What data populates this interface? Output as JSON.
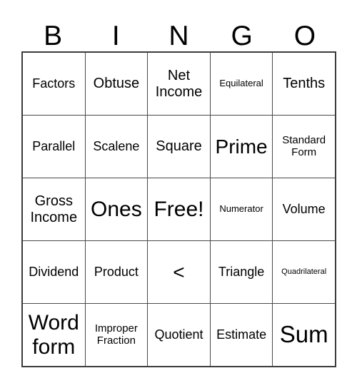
{
  "card": {
    "title": "BINGO Card",
    "header_letters": [
      "B",
      "I",
      "N",
      "G",
      "O"
    ],
    "colors": {
      "background": "#ffffff",
      "text": "#000000",
      "outer_border": "#3b3b3b",
      "inner_border": "#4a4a4a"
    },
    "rows": [
      [
        {
          "label": "Factors",
          "size": "md"
        },
        {
          "label": "Obtuse",
          "size": "lg"
        },
        {
          "label": "Net Income",
          "size": "lg"
        },
        {
          "label": "Equilateral",
          "size": "sm"
        },
        {
          "label": "Tenths",
          "size": "lg"
        }
      ],
      [
        {
          "label": "Parallel",
          "size": "md"
        },
        {
          "label": "Scalene",
          "size": "md"
        },
        {
          "label": "Square",
          "size": "lg"
        },
        {
          "label": "Prime",
          "size": "xl"
        },
        {
          "label": "Standard Form",
          "size": "smd"
        }
      ],
      [
        {
          "label": "Gross Income",
          "size": "lg"
        },
        {
          "label": "Ones",
          "size": "xxl"
        },
        {
          "label": "Free!",
          "size": "xxl"
        },
        {
          "label": "Numerator",
          "size": "sm"
        },
        {
          "label": "Volume",
          "size": "md"
        }
      ],
      [
        {
          "label": "Dividend",
          "size": "md"
        },
        {
          "label": "Product",
          "size": "md"
        },
        {
          "label": "<",
          "size": "xl"
        },
        {
          "label": "Triangle",
          "size": "md"
        },
        {
          "label": "Quadrilateral",
          "size": "xs"
        }
      ],
      [
        {
          "label": "Word form",
          "size": "xxl"
        },
        {
          "label": "Improper Fraction",
          "size": "smd"
        },
        {
          "label": "Quotient",
          "size": "md"
        },
        {
          "label": "Estimate",
          "size": "md"
        },
        {
          "label": "Sum",
          "size": "huge"
        }
      ]
    ]
  }
}
